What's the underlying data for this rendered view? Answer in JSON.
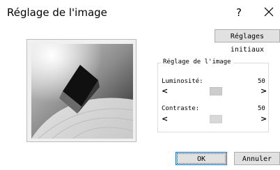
{
  "dialog": {
    "title": "Réglage de l'image",
    "help_label": "?",
    "reset_label": "Réglages initiaux",
    "ok_label": "OK",
    "cancel_label": "Annuler"
  },
  "group": {
    "label": "Réglage de l'image"
  },
  "sliders": {
    "brightness": {
      "label": "Luminosité:",
      "value": "50",
      "fraction": 0.5
    },
    "contrast": {
      "label": "Contraste:",
      "value": "50",
      "fraction": 0.5
    }
  },
  "icons": {
    "close": "close-icon",
    "left": "chevron-left-icon",
    "right": "chevron-right-icon"
  }
}
